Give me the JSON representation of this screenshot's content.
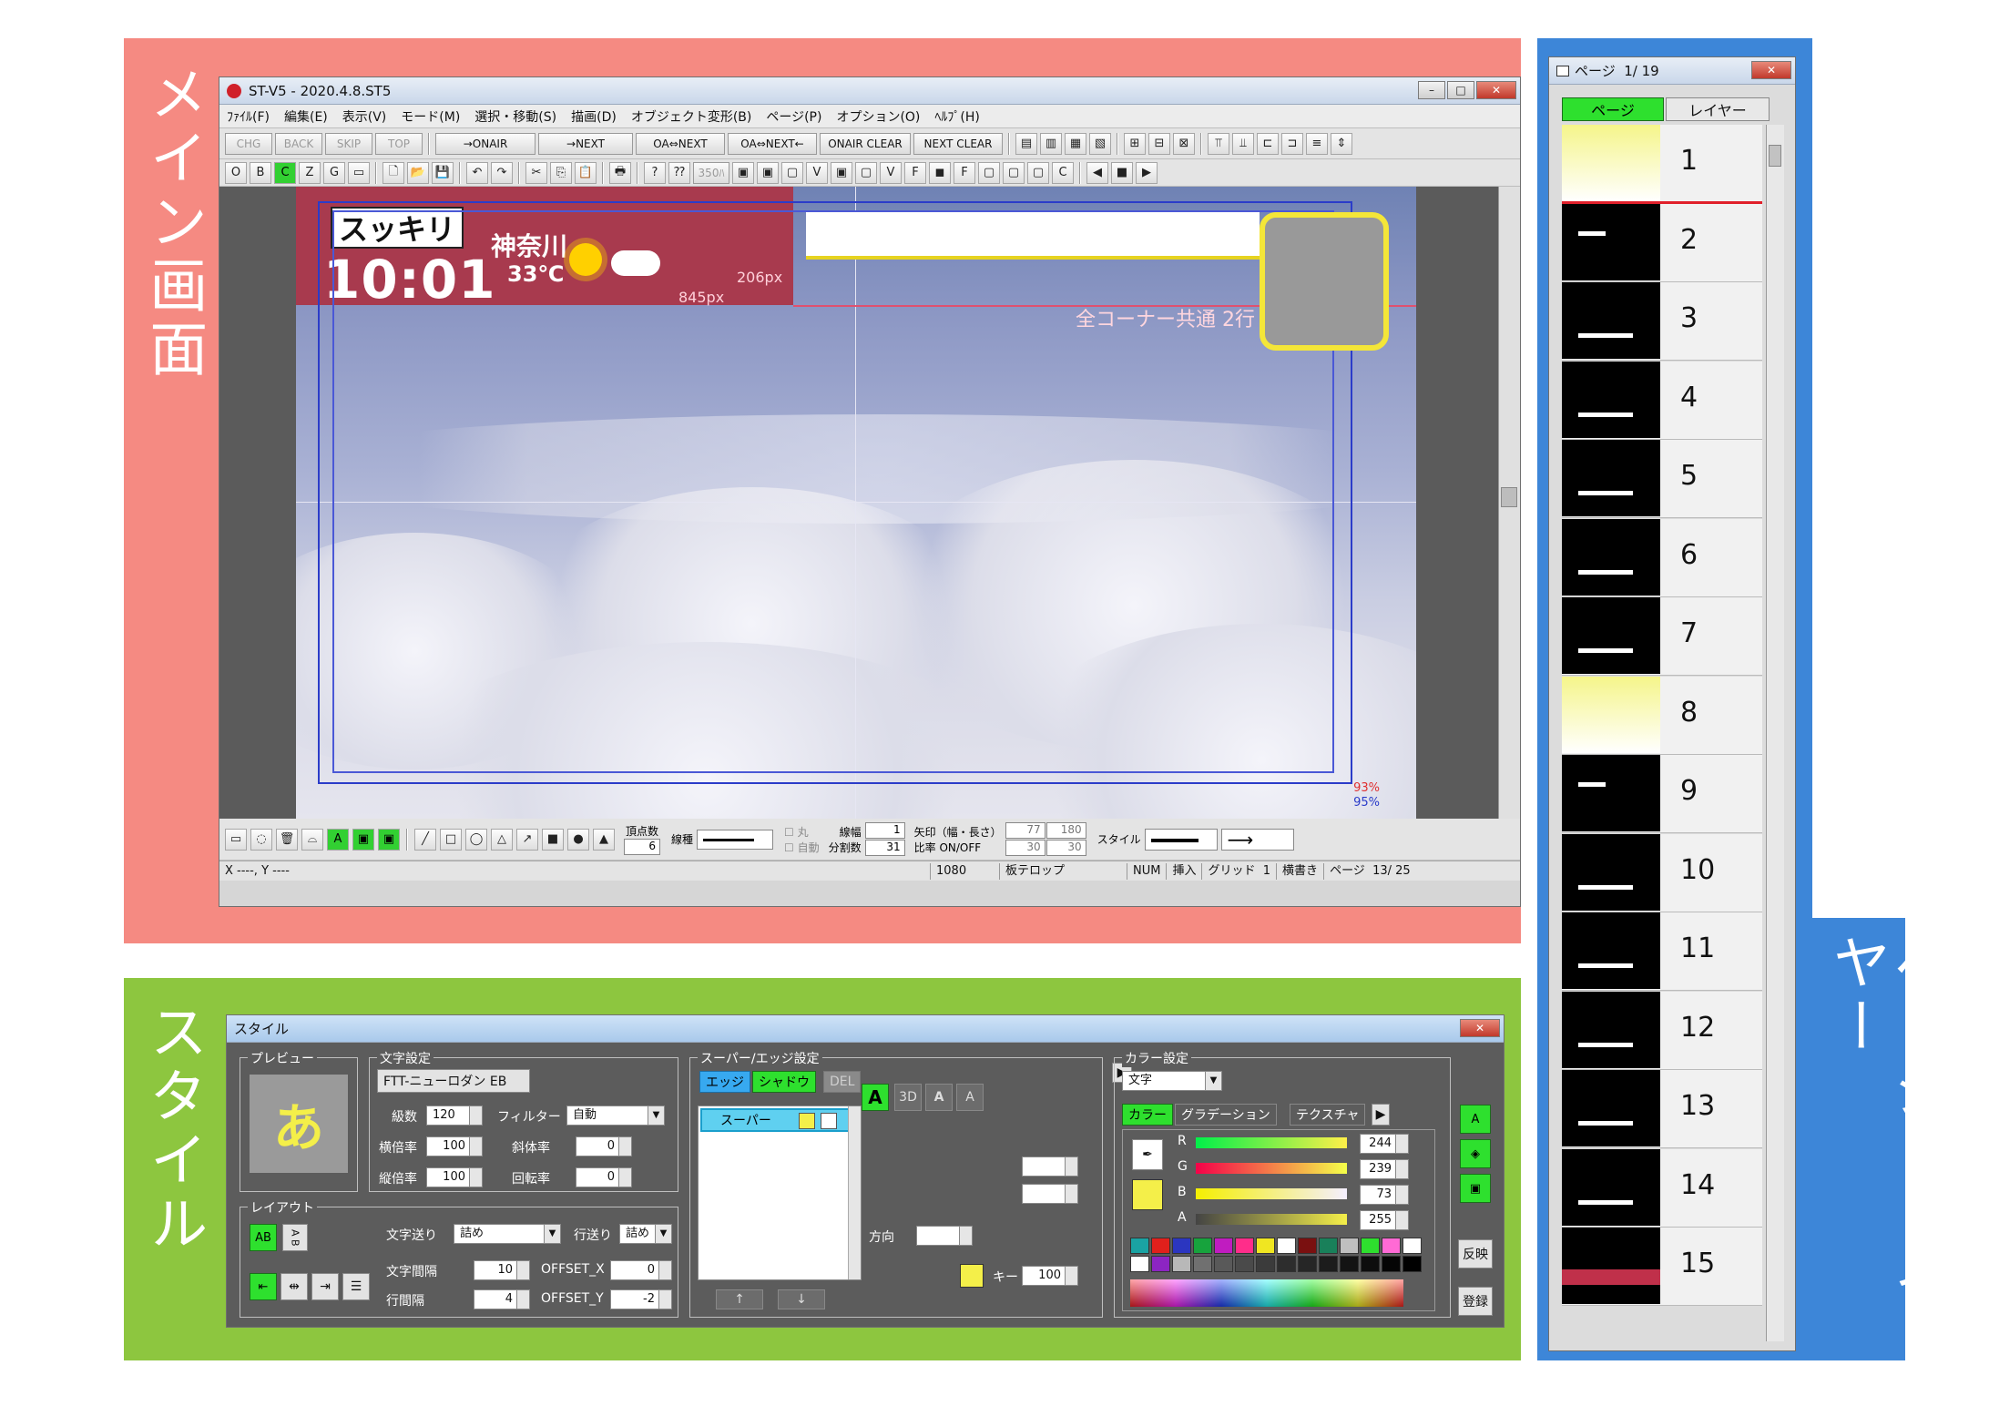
{
  "labels": {
    "main": "メイン画面",
    "style": "スタイル",
    "pages": "ページ・レイヤー"
  },
  "main_window": {
    "title": "ST-V5 - 2020.4.8.ST5",
    "menu": [
      "ﾌｧｲﾙ(F)",
      "編集(E)",
      "表示(V)",
      "モード(M)",
      "選択・移動(S)",
      "描画(D)",
      "オブジェクト変形(B)",
      "ページ(P)",
      "オプション(O)",
      "ﾍﾙﾌﾟ(H)"
    ],
    "toolbar1": [
      "CHG",
      "BACK",
      "SKIP",
      "TOP",
      "→ONAIR",
      "→NEXT",
      "OA⇔NEXT",
      "OA⇔NEXT←",
      "ONAIR CLEAR",
      "NEXT CLEAR"
    ],
    "toolbar2": [
      "O",
      "B",
      "C",
      "Z",
      "G"
    ],
    "toolbar2_extra": "350ﾊ",
    "canvas": {
      "logo": "スッキリ",
      "clock": "10:01",
      "city": "神奈川",
      "temp": "33℃",
      "px_a": "206px",
      "px_b": "845px",
      "corner_label": "全コーナー共通 2行",
      "pct_a": "93%",
      "pct_b": "95%"
    },
    "drawbar": {
      "vertex_label": "頂点数",
      "vertex_value": "6",
      "line_type_label": "線種",
      "round_label": "丸",
      "auto_label": "自動",
      "line_width_label": "線幅",
      "line_width_value": "1",
      "split_label": "分割数",
      "split_value": "31",
      "arrow_label": "矢印（幅・長さ）",
      "arrow_w": "77",
      "arrow_l": "180",
      "ratio_label": "比率 ON/OFF",
      "ratio_a": "30",
      "ratio_b": "30",
      "style_label": "スタイル"
    },
    "status": {
      "coords": "X ----,  Y ----",
      "res": "1080",
      "mode": "板テロップ",
      "num": "NUM",
      "insert": "挿入",
      "grid": "グリッド",
      "grid_value": "1",
      "write": "横書き",
      "page": "ページ",
      "page_value": "13/ 25"
    }
  },
  "style_window": {
    "title": "スタイル",
    "preview_label": "プレビュー",
    "preview_char": "あ",
    "text_settings_label": "文字設定",
    "font_name": "FTT-ニューロダン EB",
    "size_label": "級数",
    "size_value": "120",
    "filter_label": "フィルター",
    "filter_value": "自動",
    "hscale_label": "横倍率",
    "hscale_value": "100",
    "italic_label": "斜体率",
    "italic_value": "0",
    "vscale_label": "縦倍率",
    "vscale_value": "100",
    "rotate_label": "回転率",
    "rotate_value": "0",
    "layout_label": "レイアウト",
    "layout_btn_a": "AB",
    "layout_btn_b": "A B",
    "char_feed_label": "文字送り",
    "char_feed_value": "詰め",
    "line_feed_label": "行送り",
    "line_feed_value": "詰め",
    "char_gap_label": "文字間隔",
    "char_gap_value": "10",
    "offset_x_label": "OFFSET_X",
    "offset_x_value": "0",
    "line_gap_label": "行間隔",
    "line_gap_value": "4",
    "offset_y_label": "OFFSET_Y",
    "offset_y_value": "-2",
    "super_label": "スーパー/エッジ設定",
    "tab_edge": "エッジ",
    "tab_shadow": "シャドウ",
    "tab_del": "DEL",
    "super_item": "スーパー",
    "dir_label": "方向",
    "key_label": "キー",
    "key_value": "100",
    "up_arrow": "↑",
    "down_arrow": "↓",
    "color_label": "カラー設定",
    "color_target": "文字",
    "color_tabs": [
      "カラー",
      "グラデーション",
      "テクスチャ"
    ],
    "rgb": [
      {
        "name": "R",
        "value": "244"
      },
      {
        "name": "G",
        "value": "239"
      },
      {
        "name": "B",
        "value": "73"
      },
      {
        "name": "A",
        "value": "255"
      }
    ],
    "apply_label": "反映",
    "register_label": "登録",
    "swatches": [
      "#1aa3a3",
      "#e0201c",
      "#2b36c0",
      "#17a33d",
      "#c01cc0",
      "#ff2d8a",
      "#f0e621",
      "#ffffff",
      "#7a1010",
      "#19805a",
      "#bfbfbf",
      "#2edf2e",
      "#ff6ad5",
      "#ffffff",
      "#ffffff",
      "#8c25c2",
      "#b8b8b8",
      "#707070",
      "#595959",
      "#4a4a4a",
      "#3b3b3b",
      "#2d2d2d",
      "#262626",
      "#1c1c1c",
      "#131313",
      "#0d0d0d",
      "#050505",
      "#000000"
    ],
    "accent_yellow": "#f4ef49"
  },
  "page_window": {
    "title": "ページ",
    "counter": "1/ 19",
    "tab_page": "ページ",
    "tab_layer": "レイヤー",
    "pages": [
      "1",
      "2",
      "3",
      "4",
      "5",
      "6",
      "7",
      "8",
      "9",
      "10",
      "11",
      "12",
      "13",
      "14",
      "15"
    ]
  }
}
